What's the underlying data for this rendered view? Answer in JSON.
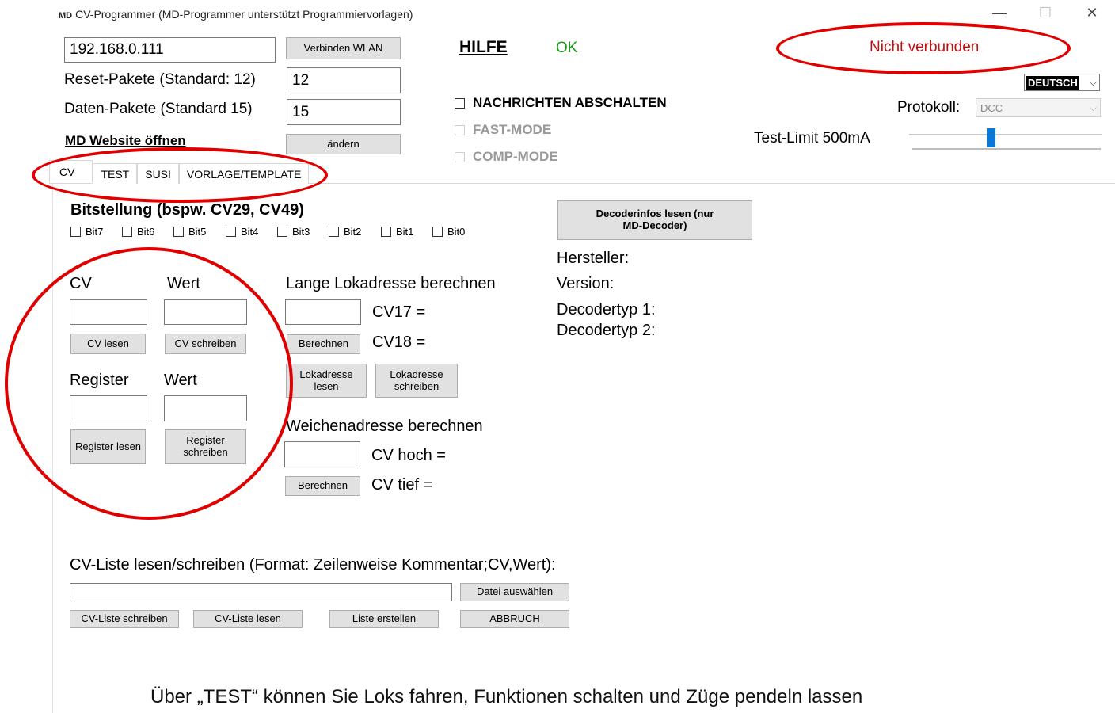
{
  "window": {
    "logo": "MD",
    "title": "CV-Programmer (MD-Programmer unterstützt Programmiervorlagen)",
    "minimize": "—",
    "maximize": "☐",
    "close": "✕"
  },
  "connection": {
    "ip_value": "192.168.0.111",
    "connect_button": "Verbinden WLAN",
    "help_link": "HILFE",
    "ok_status": "OK",
    "status": "Nicht verbunden"
  },
  "settings": {
    "reset_label": "Reset-Pakete (Standard: 12)",
    "reset_value": "12",
    "data_label": "Daten-Pakete (Standard 15)",
    "data_value": "15",
    "website_link": "MD Website öffnen",
    "change_button": "ändern",
    "language": "DEUTSCH",
    "protocol_label": "Protokoll:",
    "protocol_value": "DCC",
    "test_limit_label": "Test-Limit 500mA",
    "test_limit_slider_fraction": 0.42
  },
  "checkboxes": {
    "messages_off": "NACHRICHTEN ABSCHALTEN",
    "fast_mode": "FAST-MODE",
    "comp_mode": "COMP-MODE"
  },
  "tabs": [
    "CV",
    "TEST",
    "SUSI",
    "VORLAGE/TEMPLATE"
  ],
  "bits": {
    "heading": "Bitstellung (bspw. CV29, CV49)",
    "items": [
      "Bit7",
      "Bit6",
      "Bit5",
      "Bit4",
      "Bit3",
      "Bit2",
      "Bit1",
      "Bit0"
    ]
  },
  "cv_section": {
    "cv_label": "CV",
    "value_label": "Wert",
    "read_button": "CV lesen",
    "write_button": "CV schreiben",
    "register_label": "Register",
    "register_value_label": "Wert",
    "register_read": "Register lesen",
    "register_write": "Register schreiben"
  },
  "long_address": {
    "heading": "Lange Lokadresse berechnen",
    "cv17": "CV17 =",
    "cv18": "CV18 =",
    "calculate": "Berechnen",
    "read_address": "Lokadresse lesen",
    "write_address": "Lokadresse schreiben"
  },
  "switch_address": {
    "heading": "Weichenadresse berechnen",
    "cv_high": "CV hoch =",
    "cv_low": "CV tief =",
    "calculate": "Berechnen"
  },
  "decoder_info": {
    "button": "Decoderinfos lesen (nur MD-Decoder)",
    "manufacturer": "Hersteller:",
    "version": "Version:",
    "type1": "Decodertyp 1:",
    "type2": "Decodertyp 2:"
  },
  "cv_list": {
    "heading": "CV-Liste lesen/schreiben (Format: Zeilenweise Kommentar;CV,Wert):",
    "choose_file": "Datei auswählen",
    "write_list": "CV-Liste schreiben",
    "read_list": "CV-Liste lesen",
    "create_list": "Liste erstellen",
    "abort": "ABBRUCH"
  },
  "caption": "Über „TEST“ können Sie Loks fahren, Funktionen schalten und Züge pendeln lassen",
  "colors": {
    "highlight": "#e00000",
    "ok_green": "#1a9a1a",
    "status_red": "#c01010",
    "slider_blue": "#0a78d7"
  }
}
